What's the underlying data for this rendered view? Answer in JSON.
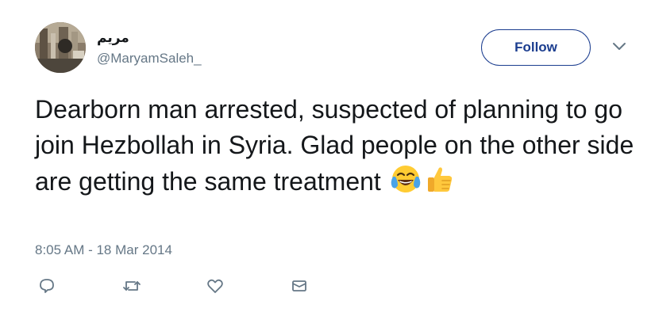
{
  "user": {
    "display_name": "مريم",
    "handle": "@MaryamSaleh_",
    "avatar_icon": "profile-photo"
  },
  "header": {
    "follow_label": "Follow",
    "menu_icon": "chevron-down-icon"
  },
  "tweet": {
    "text": "Dearborn man arrested, suspected of planning to go join Hezbollah in Syria. Glad people on the other side are getting the same treatment",
    "emojis": [
      "face-with-tears-of-joy",
      "thumbs-up"
    ],
    "timestamp": "8:05 AM - 18 Mar 2014"
  },
  "actions": [
    {
      "name": "reply",
      "icon": "reply-icon"
    },
    {
      "name": "retweet",
      "icon": "retweet-icon"
    },
    {
      "name": "like",
      "icon": "heart-icon"
    },
    {
      "name": "message",
      "icon": "envelope-icon"
    }
  ],
  "colors": {
    "text": "#14171a",
    "secondary": "#657786",
    "follow_border": "#1b3d8f",
    "icon": "#657786"
  }
}
